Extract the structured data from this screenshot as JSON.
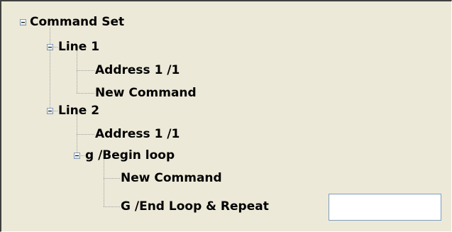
{
  "tree": {
    "root": {
      "label": "Command Set",
      "expander": "minus-box-icon",
      "children": [
        {
          "label": "Line 1",
          "expander": "minus-box-icon",
          "children": [
            {
              "label": "Address 1 /1"
            },
            {
              "label": "New Command"
            }
          ]
        },
        {
          "label": "Line 2",
          "expander": "minus-box-icon",
          "children": [
            {
              "label": "Address 1 /1"
            },
            {
              "label": "g /Begin loop",
              "expander": "minus-box-icon",
              "children": [
                {
                  "label": "New Command"
                },
                {
                  "label": "G /End Loop & Repeat"
                }
              ]
            }
          ]
        }
      ]
    },
    "edit_field": {
      "value": "",
      "placeholder": ""
    }
  }
}
